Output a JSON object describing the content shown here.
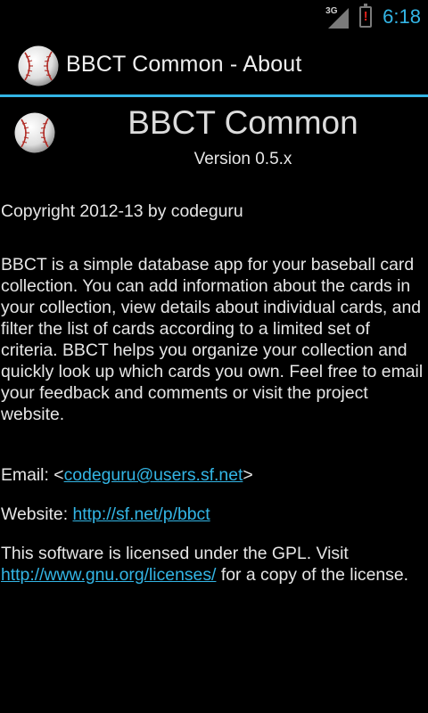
{
  "status_bar": {
    "network": "3G",
    "battery_alert": "!",
    "time": "6:18",
    "colors": {
      "accent": "#33b5e5",
      "alert": "#e0221b"
    }
  },
  "action_bar": {
    "icon": "baseball-icon",
    "title": "BBCT Common - About"
  },
  "about": {
    "app_name": "BBCT Common",
    "version": "Version 0.5.x",
    "copyright": "Copyright 2012-13 by codeguru",
    "description": "BBCT is a simple database app for your baseball card collection. You can add information about the cards in your collection, view details about individual cards, and filter the list of cards according to a limited set of criteria. BBCT helps you organize your collection and quickly look up which cards you own. Feel free to email your feedback and comments or visit the project website.",
    "email": {
      "prefix": "Email: <",
      "address": "codeguru@users.sf.net",
      "suffix": ">"
    },
    "website": {
      "prefix": "Website: ",
      "url": "http://sf.net/p/bbct"
    },
    "license": {
      "before": "This software is licensed under the GPL. Visit ",
      "url": "http://www.gnu.org/licenses/",
      "after": " for a copy of the license."
    }
  }
}
